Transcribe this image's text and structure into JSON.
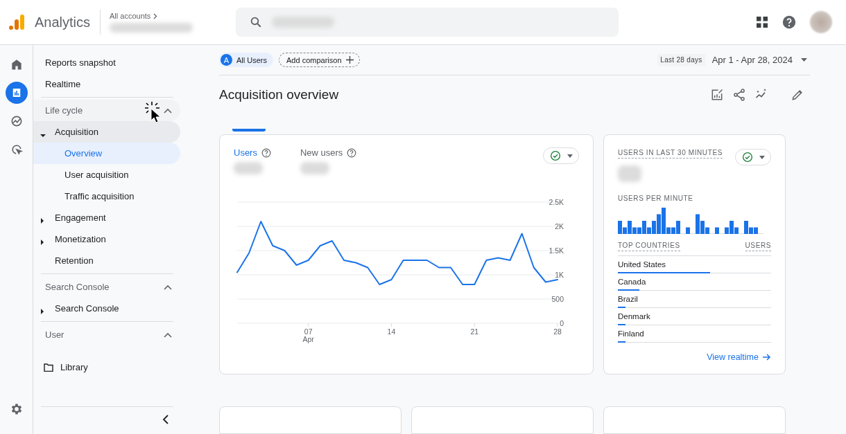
{
  "header": {
    "product": "Analytics",
    "breadcrumb": "All accounts"
  },
  "rail": [
    {
      "kind": "home",
      "selected": false
    },
    {
      "kind": "reports",
      "selected": true
    },
    {
      "kind": "explore",
      "selected": false
    },
    {
      "kind": "advertising",
      "selected": false
    }
  ],
  "nav": {
    "top_items": [
      {
        "label": "Reports snapshot",
        "selected": false
      },
      {
        "label": "Realtime",
        "selected": false
      }
    ],
    "sections": [
      {
        "title": "Life cycle",
        "expanded": true,
        "items": [
          {
            "label": "Acquisition",
            "expanded": true,
            "selected": false,
            "children": [
              {
                "label": "Overview",
                "selected": true
              },
              {
                "label": "User acquisition",
                "selected": false
              },
              {
                "label": "Traffic acquisition",
                "selected": false
              }
            ]
          },
          {
            "label": "Engagement",
            "expanded": false,
            "selected": false
          },
          {
            "label": "Monetization",
            "expanded": false,
            "selected": false
          },
          {
            "label": "Retention",
            "selected": false
          }
        ]
      },
      {
        "title": "Search Console",
        "expanded": true,
        "items": [
          {
            "label": "Search Console",
            "expanded": false,
            "selected": false
          }
        ]
      },
      {
        "title": "User",
        "expanded": true
      }
    ],
    "library": "Library"
  },
  "toolbar": {
    "segment_badge": "A",
    "segment": "All Users",
    "add_comparison": "Add comparison",
    "range_label": "Last 28 days",
    "date_range": "Apr 1 - Apr 28, 2024"
  },
  "page_title": "Acquisition overview",
  "users_card": {
    "tabs": [
      {
        "label": "Users",
        "selected": true
      },
      {
        "label": "New users",
        "selected": false
      }
    ],
    "chart_data": {
      "type": "line",
      "x": [
        1,
        2,
        3,
        4,
        5,
        6,
        7,
        8,
        9,
        10,
        11,
        12,
        13,
        14,
        15,
        16,
        17,
        18,
        19,
        20,
        21,
        22,
        23,
        24,
        25,
        26,
        27,
        28
      ],
      "series": [
        {
          "color": "#1a73e8",
          "values": [
            1050,
            1450,
            2100,
            1600,
            1500,
            1200,
            1300,
            1600,
            1700,
            1300,
            1250,
            1150,
            800,
            900,
            1300,
            1300,
            1300,
            1150,
            1150,
            800,
            800,
            1300,
            1350,
            1300,
            1850,
            1150,
            850,
            900
          ]
        }
      ],
      "ylim": [
        0,
        2500
      ],
      "yticks": [
        {
          "value": 0,
          "label": "0"
        },
        {
          "value": 500,
          "label": "500"
        },
        {
          "value": 1000,
          "label": "1K"
        },
        {
          "value": 1500,
          "label": "1.5K"
        },
        {
          "value": 2000,
          "label": "2K"
        },
        {
          "value": 2500,
          "label": "2.5K"
        }
      ],
      "xlim": [
        1,
        28
      ],
      "grid": true,
      "xticks": [
        {
          "value": 7,
          "label": "07\nApr"
        },
        {
          "value": 14,
          "label": "14"
        },
        {
          "value": 21,
          "label": "21"
        },
        {
          "value": 28,
          "label": "28"
        }
      ]
    }
  },
  "realtime_card": {
    "title": "USERS IN LAST 30 MINUTES",
    "per_minute_label": "USERS PER MINUTE",
    "countries_heading": "TOP COUNTRIES",
    "users_heading": "USERS",
    "countries": [
      {
        "name": "United States",
        "level": 0.6
      },
      {
        "name": "Canada",
        "level": 0.14
      },
      {
        "name": "Brazil",
        "level": 0.05
      },
      {
        "name": "Denmark",
        "level": 0.05
      },
      {
        "name": "Finland",
        "level": 0.05
      }
    ],
    "link": "View realtime"
  }
}
